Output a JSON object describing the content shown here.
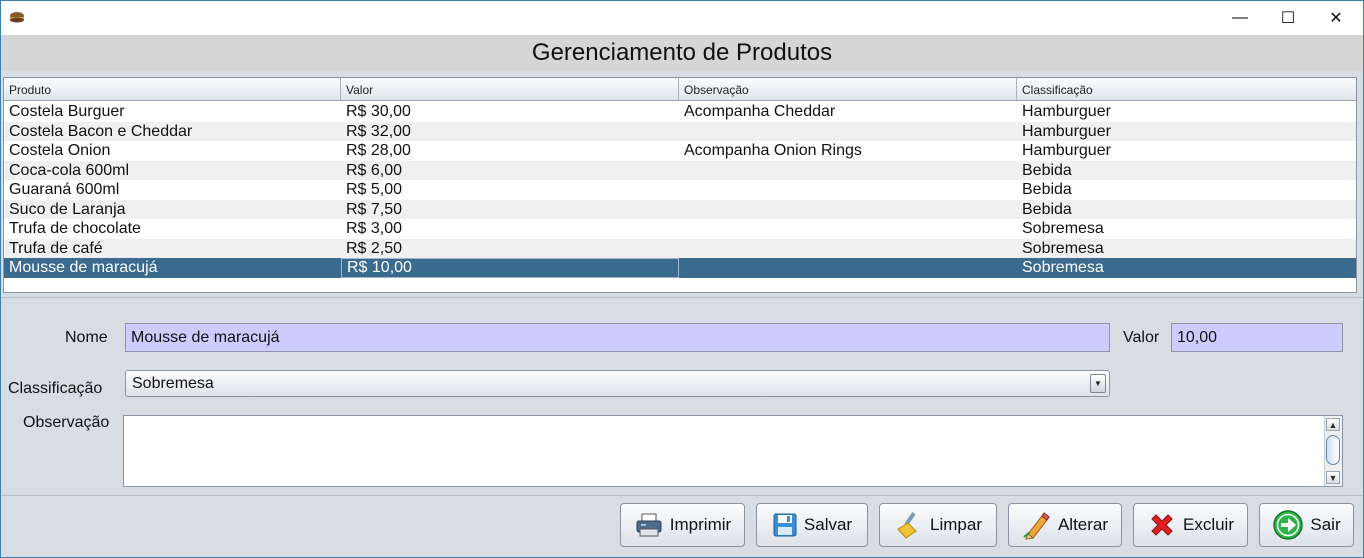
{
  "window": {
    "minimize_glyph": "—",
    "maximize_glyph": "☐",
    "close_glyph": "✕"
  },
  "header": {
    "title": "Gerenciamento de Produtos"
  },
  "table": {
    "columns": [
      "Produto",
      "Valor",
      "Observação",
      "Classificação"
    ],
    "rows": [
      [
        "Costela Burguer",
        "R$ 30,00",
        "Acompanha Cheddar",
        "Hamburguer"
      ],
      [
        "Costela Bacon e Cheddar",
        "R$ 32,00",
        "",
        "Hamburguer"
      ],
      [
        "Costela Onion",
        "R$ 28,00",
        "Acompanha Onion Rings",
        "Hamburguer"
      ],
      [
        "Coca-cola 600ml",
        "R$ 6,00",
        "",
        "Bebida"
      ],
      [
        "Guaraná 600ml",
        "R$ 5,00",
        "",
        "Bebida"
      ],
      [
        "Suco de Laranja",
        "R$ 7,50",
        "",
        "Bebida"
      ],
      [
        "Trufa de chocolate",
        "R$ 3,00",
        "",
        "Sobremesa"
      ],
      [
        "Trufa de café",
        "R$ 2,50",
        "",
        "Sobremesa"
      ],
      [
        "Mousse de maracujá",
        "R$ 10,00",
        "",
        "Sobremesa"
      ]
    ],
    "selected_row": 8
  },
  "form": {
    "nome_label": "Nome",
    "nome_value": "Mousse de maracujá",
    "valor_label": "Valor",
    "valor_value": "10,00",
    "classificacao_label": "Classificação",
    "classificacao_value": "Sobremesa",
    "observacao_label": "Observação",
    "observacao_value": ""
  },
  "buttons": {
    "imprimir": "Imprimir",
    "salvar": "Salvar",
    "limpar": "Limpar",
    "alterar": "Alterar",
    "excluir": "Excluir",
    "sair": "Sair"
  },
  "icons": {
    "app": "app-icon",
    "printer": "printer-icon",
    "save": "floppy-disk-icon",
    "clear": "brush-icon",
    "edit": "pencil-icon",
    "delete": "red-x-icon",
    "exit": "green-arrow-icon"
  },
  "colors": {
    "selection": "#3a6a8e",
    "field_bg": "#ccccff",
    "exit_green": "#2db34a",
    "delete_red": "#e02020"
  }
}
